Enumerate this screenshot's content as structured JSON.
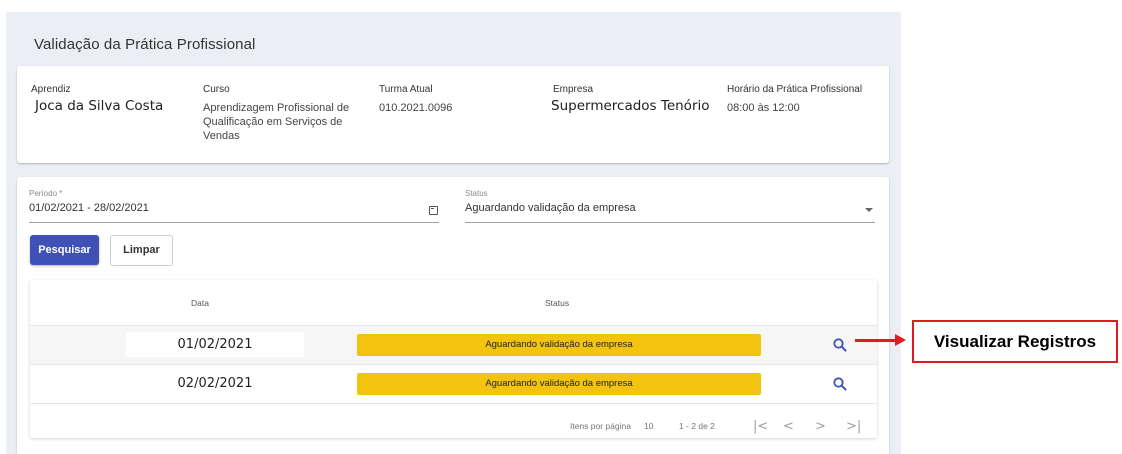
{
  "page": {
    "title": "Validação da Prática Profissional"
  },
  "info": {
    "aprendiz_label": "Aprendiz",
    "aprendiz_value": "Joca da Silva Costa",
    "curso_label": "Curso",
    "curso_value": "Aprendizagem Profissional de Qualificação em Serviços de Vendas",
    "turma_label": "Turma Atual",
    "turma_value": "010.2021.0096",
    "empresa_label": "Empresa",
    "empresa_value": "Supermercados Tenório",
    "horario_label": "Horário da Prática Profissional",
    "horario_value": "08:00 às 12:00"
  },
  "filters": {
    "periodo_label": "Período *",
    "periodo_value": "01/02/2021 - 28/02/2021",
    "periodo_icon": "calendar-icon",
    "status_label": "Status",
    "status_value": "Aguardando validação da empresa",
    "status_icon": "chevron-down-icon",
    "pesquisar_label": "Pesquisar",
    "limpar_label": "Limpar"
  },
  "table": {
    "headers": {
      "data": "Data",
      "status": "Status"
    },
    "rows": [
      {
        "data": "01/02/2021",
        "status": "Aguardando validação da empresa",
        "action_icon": "search-icon"
      },
      {
        "data": "02/02/2021",
        "status": "Aguardando validação da empresa",
        "action_icon": "search-icon"
      }
    ],
    "status_color": "#f2c40f"
  },
  "paginator": {
    "items_label": "Itens por página",
    "items_value": "10",
    "range": "1 - 2 de 2",
    "first_icon": "|<",
    "prev_icon": "<",
    "next_icon": ">",
    "last_icon": ">|"
  },
  "annotation": {
    "label": "Visualizar Registros",
    "color": "#e11b22"
  },
  "colors": {
    "primary": "#3f51b5",
    "background": "#eceef5"
  }
}
